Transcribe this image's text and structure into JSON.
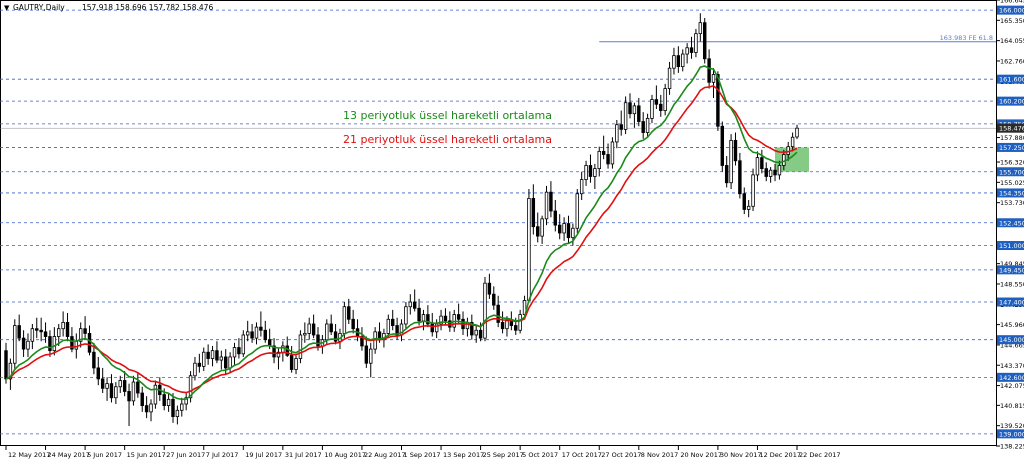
{
  "header": {
    "symbol": "GAUTRY,Daily",
    "ohlc": "157.918 158.696 157.782 158.476"
  },
  "annotations": {
    "ema13": "13 periyotluk üssel hareketli ortalama",
    "ema21": "21 periyotluk üssel hareketli ortalama",
    "fib_label": "163.983 FE 61.8"
  },
  "colors": {
    "ema13": "#1a8a1a",
    "ema21": "#e01010",
    "level_line": "#3a5fcd",
    "fib_line": "#5a7fd0",
    "highlight_box": "#5cb85c",
    "label_bg": "#1f5fbf",
    "current_price_bg": "#2b2b2b"
  },
  "chart_data": {
    "type": "candlestick",
    "timeframe": "Daily",
    "ylim": [
      138.225,
      166.645
    ],
    "y_ticks": [
      "166.645",
      "165.350",
      "164.055",
      "162.760",
      "161.465",
      "160.200",
      "158.476",
      "157.880",
      "156.320",
      "155.025",
      "153.730",
      "152.435",
      "151.140",
      "149.845",
      "148.550",
      "147.255",
      "145.960",
      "144.665",
      "143.370",
      "142.075",
      "140.815",
      "139.520",
      "138.225"
    ],
    "x_ticks": [
      "12 May 2017",
      "24 May 2017",
      "5 Jun 2017",
      "15 Jun 2017",
      "27 Jun 2017",
      "7 Jul 2017",
      "19 Jul 2017",
      "31 Jul 2017",
      "10 Aug 2017",
      "22 Aug 2017",
      "1 Sep 2017",
      "13 Sep 2017",
      "25 Sep 2017",
      "5 Oct 2017",
      "17 Oct 2017",
      "27 Oct 2017",
      "8 Nov 2017",
      "20 Nov 2017",
      "30 Nov 2017",
      "12 Dec 2017",
      "22 Dec 2017"
    ],
    "levels": [
      {
        "value": 166.0,
        "label": "166.000"
      },
      {
        "value": 161.6,
        "label": "161.600"
      },
      {
        "value": 160.2,
        "label": "160.200"
      },
      {
        "value": 158.75,
        "label": "158.750"
      },
      {
        "value": 157.25,
        "label": "157.250"
      },
      {
        "value": 155.7,
        "label": "155.700"
      },
      {
        "value": 154.35,
        "label": "154.350"
      },
      {
        "value": 152.45,
        "label": "152.450"
      },
      {
        "value": 151.0,
        "label": "151.000"
      },
      {
        "value": 149.45,
        "label": "149.450"
      },
      {
        "value": 147.4,
        "label": "147.400"
      },
      {
        "value": 145.0,
        "label": "145.000"
      },
      {
        "value": 142.6,
        "label": "142.600"
      },
      {
        "value": 139.0,
        "label": "139.000"
      }
    ],
    "fib_level": {
      "value": 163.983,
      "label": "163.983 FE 61.8",
      "from_date": "27 Oct 2017"
    },
    "current_price": {
      "value": 158.476,
      "label": "158.476"
    },
    "highlight_box": {
      "from_date": "22 Dec 2017",
      "to_date": "28 Dec 2017",
      "y_low": 155.7,
      "y_high": 157.25
    },
    "ohlc": [
      [
        144.3,
        144.8,
        142.2,
        142.5
      ],
      [
        142.5,
        143.8,
        141.8,
        143.5
      ],
      [
        143.5,
        146.3,
        143.1,
        145.9
      ],
      [
        145.9,
        146.6,
        144.9,
        145.1
      ],
      [
        145.1,
        145.6,
        143.9,
        144.4
      ],
      [
        144.4,
        145.4,
        143.9,
        144.9
      ],
      [
        144.9,
        146.0,
        144.4,
        145.7
      ],
      [
        145.7,
        146.4,
        145.1,
        145.6
      ],
      [
        145.6,
        146.4,
        144.9,
        145.5
      ],
      [
        145.5,
        146.1,
        144.8,
        145.2
      ],
      [
        145.2,
        145.6,
        143.9,
        144.3
      ],
      [
        144.3,
        145.8,
        144.0,
        145.2
      ],
      [
        145.2,
        146.0,
        144.6,
        145.7
      ],
      [
        145.7,
        146.8,
        145.2,
        146.1
      ],
      [
        146.1,
        146.7,
        144.9,
        145.2
      ],
      [
        145.2,
        145.8,
        144.2,
        144.4
      ],
      [
        144.4,
        145.4,
        143.8,
        144.9
      ],
      [
        144.9,
        146.1,
        144.5,
        145.7
      ],
      [
        145.7,
        146.5,
        145.0,
        145.4
      ],
      [
        145.4,
        145.9,
        144.0,
        144.2
      ],
      [
        144.2,
        144.8,
        142.8,
        143.2
      ],
      [
        143.2,
        143.9,
        142.1,
        142.5
      ],
      [
        142.5,
        143.2,
        141.6,
        141.9
      ],
      [
        141.9,
        142.6,
        141.1,
        142.2
      ],
      [
        142.2,
        142.8,
        141.0,
        141.3
      ],
      [
        141.3,
        142.3,
        140.9,
        142.0
      ],
      [
        142.0,
        142.7,
        141.6,
        142.4
      ],
      [
        142.4,
        143.0,
        141.4,
        141.7
      ],
      [
        141.7,
        142.2,
        139.5,
        141.1
      ],
      [
        141.1,
        142.7,
        140.8,
        142.3
      ],
      [
        142.3,
        142.9,
        141.3,
        141.6
      ],
      [
        141.6,
        142.0,
        140.4,
        140.8
      ],
      [
        140.8,
        141.4,
        140.0,
        140.4
      ],
      [
        140.4,
        141.2,
        139.8,
        140.9
      ],
      [
        140.9,
        142.4,
        140.6,
        142.1
      ],
      [
        142.1,
        142.6,
        141.1,
        141.5
      ],
      [
        141.5,
        141.9,
        140.5,
        140.8
      ],
      [
        140.8,
        141.6,
        140.4,
        141.2
      ],
      [
        141.2,
        141.6,
        139.7,
        140.1
      ],
      [
        140.1,
        140.8,
        139.6,
        140.5
      ],
      [
        140.5,
        141.3,
        140.1,
        140.9
      ],
      [
        140.9,
        141.6,
        140.5,
        141.3
      ],
      [
        141.3,
        143.0,
        141.0,
        142.7
      ],
      [
        142.7,
        143.9,
        142.4,
        143.5
      ],
      [
        143.5,
        144.1,
        142.9,
        143.3
      ],
      [
        143.3,
        144.5,
        143.0,
        144.2
      ],
      [
        144.2,
        144.7,
        143.4,
        143.8
      ],
      [
        143.8,
        144.6,
        143.3,
        144.3
      ],
      [
        144.3,
        144.9,
        143.5,
        143.7
      ],
      [
        143.7,
        144.3,
        143.1,
        143.9
      ],
      [
        143.9,
        144.4,
        142.8,
        143.2
      ],
      [
        143.2,
        144.2,
        142.9,
        143.9
      ],
      [
        143.9,
        144.8,
        143.4,
        144.5
      ],
      [
        144.5,
        145.1,
        143.8,
        144.1
      ],
      [
        144.1,
        145.6,
        143.9,
        145.3
      ],
      [
        145.3,
        146.2,
        144.9,
        145.5
      ],
      [
        145.5,
        146.0,
        144.8,
        145.1
      ],
      [
        145.1,
        146.1,
        144.7,
        145.8
      ],
      [
        145.8,
        146.8,
        145.2,
        145.6
      ],
      [
        145.6,
        146.2,
        144.8,
        145.0
      ],
      [
        145.0,
        145.7,
        144.4,
        144.6
      ],
      [
        144.6,
        145.1,
        143.5,
        143.9
      ],
      [
        143.9,
        144.5,
        143.1,
        144.2
      ],
      [
        144.2,
        144.9,
        143.6,
        144.6
      ],
      [
        144.6,
        145.2,
        143.9,
        144.0
      ],
      [
        144.0,
        144.6,
        142.9,
        143.1
      ],
      [
        143.1,
        144.0,
        142.8,
        143.8
      ],
      [
        143.8,
        145.6,
        143.5,
        145.3
      ],
      [
        145.3,
        146.1,
        144.8,
        145.4
      ],
      [
        145.4,
        146.4,
        145.0,
        146.0
      ],
      [
        146.0,
        146.6,
        145.1,
        145.3
      ],
      [
        145.3,
        145.8,
        144.3,
        144.6
      ],
      [
        144.6,
        145.3,
        144.1,
        145.0
      ],
      [
        145.0,
        146.3,
        144.7,
        146.0
      ],
      [
        146.0,
        146.6,
        145.3,
        145.5
      ],
      [
        145.5,
        146.0,
        144.7,
        144.9
      ],
      [
        144.9,
        145.7,
        144.4,
        145.4
      ],
      [
        145.4,
        147.4,
        145.1,
        147.1
      ],
      [
        147.1,
        147.6,
        146.0,
        146.3
      ],
      [
        146.3,
        146.9,
        145.4,
        145.7
      ],
      [
        145.7,
        146.3,
        144.9,
        145.2
      ],
      [
        145.2,
        145.8,
        144.3,
        144.6
      ],
      [
        144.6,
        145.2,
        143.2,
        143.5
      ],
      [
        143.5,
        144.8,
        142.6,
        144.4
      ],
      [
        144.4,
        145.8,
        144.1,
        145.5
      ],
      [
        145.5,
        146.1,
        144.8,
        145.0
      ],
      [
        145.0,
        145.7,
        144.5,
        145.4
      ],
      [
        145.4,
        146.6,
        145.1,
        146.3
      ],
      [
        146.3,
        146.9,
        145.6,
        145.9
      ],
      [
        145.9,
        146.4,
        145.0,
        145.3
      ],
      [
        145.3,
        146.3,
        144.9,
        146.0
      ],
      [
        146.0,
        147.4,
        145.7,
        147.1
      ],
      [
        147.1,
        147.9,
        146.6,
        147.4
      ],
      [
        147.4,
        148.2,
        146.8,
        147.0
      ],
      [
        147.0,
        147.6,
        145.9,
        146.2
      ],
      [
        146.2,
        146.9,
        145.6,
        146.6
      ],
      [
        146.6,
        147.2,
        145.8,
        146.0
      ],
      [
        146.0,
        146.7,
        145.2,
        145.5
      ],
      [
        145.5,
        146.3,
        145.1,
        146.0
      ],
      [
        146.0,
        146.9,
        145.6,
        146.5
      ],
      [
        146.5,
        147.0,
        145.9,
        146.2
      ],
      [
        146.2,
        146.8,
        145.5,
        145.8
      ],
      [
        145.8,
        146.9,
        145.5,
        146.6
      ],
      [
        146.6,
        147.3,
        146.0,
        146.3
      ],
      [
        146.3,
        146.8,
        145.3,
        145.7
      ],
      [
        145.7,
        146.4,
        145.2,
        146.1
      ],
      [
        146.1,
        146.6,
        145.0,
        145.3
      ],
      [
        145.3,
        145.9,
        144.8,
        145.6
      ],
      [
        145.6,
        146.1,
        144.9,
        145.1
      ],
      [
        145.1,
        149.0,
        144.9,
        148.6
      ],
      [
        148.6,
        149.2,
        147.6,
        147.9
      ],
      [
        147.9,
        148.4,
        146.9,
        147.2
      ],
      [
        147.2,
        147.8,
        145.8,
        146.1
      ],
      [
        146.1,
        146.8,
        145.4,
        145.7
      ],
      [
        145.7,
        146.5,
        145.2,
        146.2
      ],
      [
        146.2,
        146.8,
        145.6,
        145.9
      ],
      [
        145.9,
        146.4,
        145.3,
        145.6
      ],
      [
        145.6,
        146.9,
        145.4,
        146.6
      ],
      [
        146.6,
        147.8,
        146.3,
        147.5
      ],
      [
        147.5,
        154.6,
        150.8,
        154.0
      ],
      [
        154.0,
        154.9,
        151.7,
        152.2
      ],
      [
        152.2,
        153.1,
        151.2,
        151.6
      ],
      [
        151.6,
        152.9,
        151.1,
        152.7
      ],
      [
        152.7,
        154.8,
        152.3,
        154.4
      ],
      [
        154.4,
        155.1,
        152.8,
        153.2
      ],
      [
        153.2,
        153.9,
        151.9,
        152.3
      ],
      [
        152.3,
        153.0,
        151.4,
        151.8
      ],
      [
        151.8,
        152.8,
        151.3,
        152.4
      ],
      [
        152.4,
        152.9,
        151.1,
        151.5
      ],
      [
        151.5,
        152.4,
        151.0,
        152.1
      ],
      [
        152.1,
        154.6,
        151.8,
        154.3
      ],
      [
        154.3,
        155.7,
        153.9,
        155.2
      ],
      [
        155.2,
        156.4,
        154.8,
        156.1
      ],
      [
        156.1,
        156.8,
        155.0,
        155.4
      ],
      [
        155.4,
        156.2,
        154.6,
        155.9
      ],
      [
        155.9,
        157.3,
        155.4,
        157.0
      ],
      [
        157.0,
        158.0,
        156.5,
        156.8
      ],
      [
        156.8,
        157.5,
        155.9,
        156.2
      ],
      [
        156.2,
        157.9,
        155.9,
        157.6
      ],
      [
        157.6,
        159.0,
        157.2,
        158.7
      ],
      [
        158.7,
        159.6,
        158.0,
        158.4
      ],
      [
        158.4,
        160.5,
        158.1,
        160.1
      ],
      [
        160.1,
        160.7,
        159.1,
        159.4
      ],
      [
        159.4,
        160.1,
        158.5,
        159.9
      ],
      [
        159.9,
        160.4,
        158.6,
        158.9
      ],
      [
        158.9,
        159.5,
        157.8,
        158.2
      ],
      [
        158.2,
        159.4,
        157.9,
        159.1
      ],
      [
        159.1,
        160.6,
        158.8,
        160.3
      ],
      [
        160.3,
        161.2,
        159.7,
        160.0
      ],
      [
        160.0,
        160.6,
        159.2,
        159.6
      ],
      [
        159.6,
        161.3,
        159.3,
        161.0
      ],
      [
        161.0,
        162.7,
        160.6,
        162.3
      ],
      [
        162.3,
        163.6,
        161.9,
        163.1
      ],
      [
        163.1,
        163.7,
        162.0,
        162.4
      ],
      [
        162.4,
        163.5,
        162.1,
        163.2
      ],
      [
        163.2,
        163.9,
        162.6,
        163.6
      ],
      [
        163.6,
        164.3,
        162.9,
        163.3
      ],
      [
        163.3,
        164.8,
        163.0,
        164.5
      ],
      [
        164.5,
        165.8,
        164.0,
        165.2
      ],
      [
        165.2,
        165.5,
        162.6,
        162.9
      ],
      [
        162.9,
        163.5,
        161.0,
        161.4
      ],
      [
        161.4,
        162.3,
        160.4,
        161.9
      ],
      [
        161.9,
        162.1,
        158.3,
        158.6
      ],
      [
        158.6,
        158.9,
        155.7,
        156.1
      ],
      [
        156.1,
        156.7,
        154.7,
        155.0
      ],
      [
        155.0,
        158.1,
        154.6,
        157.7
      ],
      [
        157.7,
        158.2,
        156.1,
        156.4
      ],
      [
        156.4,
        156.9,
        154.0,
        154.3
      ],
      [
        154.3,
        154.7,
        153.0,
        153.3
      ],
      [
        153.3,
        153.9,
        152.8,
        153.5
      ],
      [
        153.5,
        155.9,
        153.2,
        155.5
      ],
      [
        155.5,
        157.0,
        155.1,
        156.6
      ],
      [
        156.6,
        157.1,
        155.6,
        155.9
      ],
      [
        155.9,
        156.3,
        155.1,
        155.4
      ],
      [
        155.4,
        156.0,
        155.0,
        155.8
      ],
      [
        155.8,
        156.2,
        155.1,
        155.5
      ],
      [
        155.5,
        156.4,
        155.2,
        156.1
      ],
      [
        156.1,
        157.1,
        155.8,
        156.8
      ],
      [
        156.8,
        157.6,
        156.4,
        157.3
      ],
      [
        157.3,
        158.2,
        157.0,
        157.9
      ],
      [
        157.918,
        158.696,
        157.782,
        158.476
      ]
    ]
  }
}
